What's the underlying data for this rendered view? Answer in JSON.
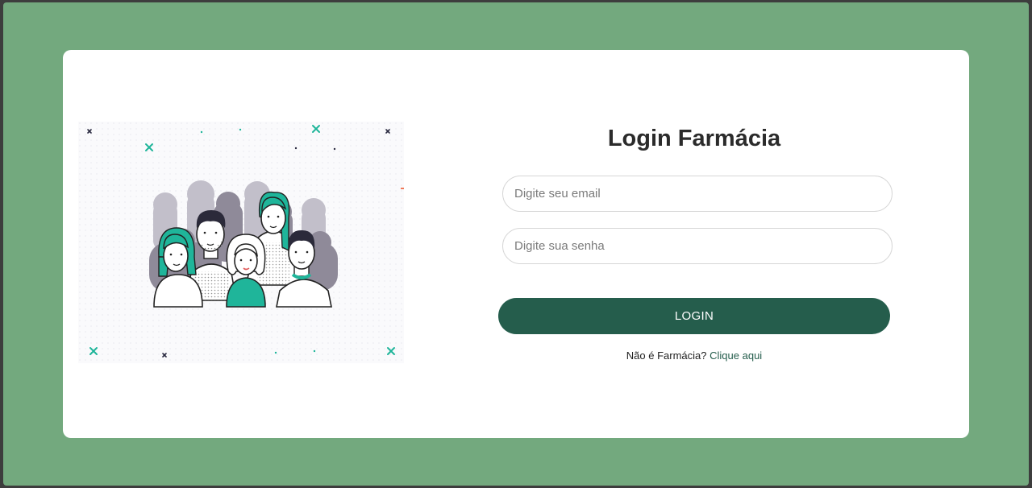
{
  "login": {
    "title": "Login Farmácia",
    "email_placeholder": "Digite seu email",
    "email_value": "",
    "password_placeholder": "Digite sua senha",
    "password_value": "",
    "button_label": "LOGIN",
    "footer_question": "Não é Farmácia?",
    "footer_link": "Clique aqui"
  },
  "illustration": {
    "icon": "people-group-illustration"
  },
  "colors": {
    "background": "#73a97e",
    "card": "#ffffff",
    "primary": "#255d4c",
    "accent_teal": "#1fb59a"
  }
}
